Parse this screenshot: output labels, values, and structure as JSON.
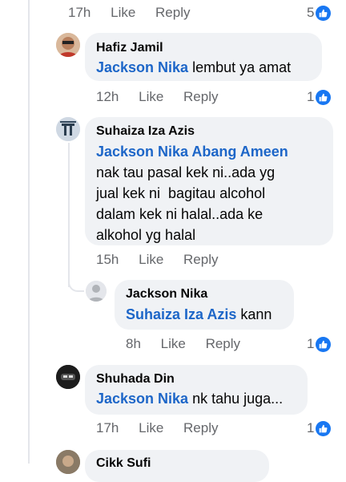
{
  "top_meta": {
    "time": "17h",
    "like": "Like",
    "reply": "Reply",
    "reactions": "5"
  },
  "comments": [
    {
      "author": "Hafiz Jamil",
      "mention": "Jackson Nika",
      "text": " lembut ya amat",
      "time": "12h",
      "like": "Like",
      "reply": "Reply",
      "reactions": "1"
    },
    {
      "author": "Suhaiza Iza Azis",
      "mention": "Jackson Nika Abang Ameen",
      "text_lines": [
        "nak tau pasal kek ni..ada yg",
        "jual kek ni  bagitau alcohol",
        "dalam kek ni halal..ada ke",
        "alkohol yg halal"
      ],
      "time": "15h",
      "like": "Like",
      "reply": "Reply"
    },
    {
      "author": "Jackson Nika",
      "mention": "Suhaiza Iza Azis",
      "text": " kann",
      "time": "8h",
      "like": "Like",
      "reply": "Reply",
      "reactions": "1"
    },
    {
      "author": "Shuhada Din",
      "mention": "Jackson Nika",
      "text": " nk tahu juga...",
      "time": "17h",
      "like": "Like",
      "reply": "Reply",
      "reactions": "1"
    },
    {
      "author": "Cikk Sufi"
    }
  ],
  "icons": {
    "like_badge": "thumbs-up-icon"
  },
  "colors": {
    "mention": "#1d66c8",
    "like_badge": "#1877f2",
    "bubble": "#f0f2f5"
  }
}
